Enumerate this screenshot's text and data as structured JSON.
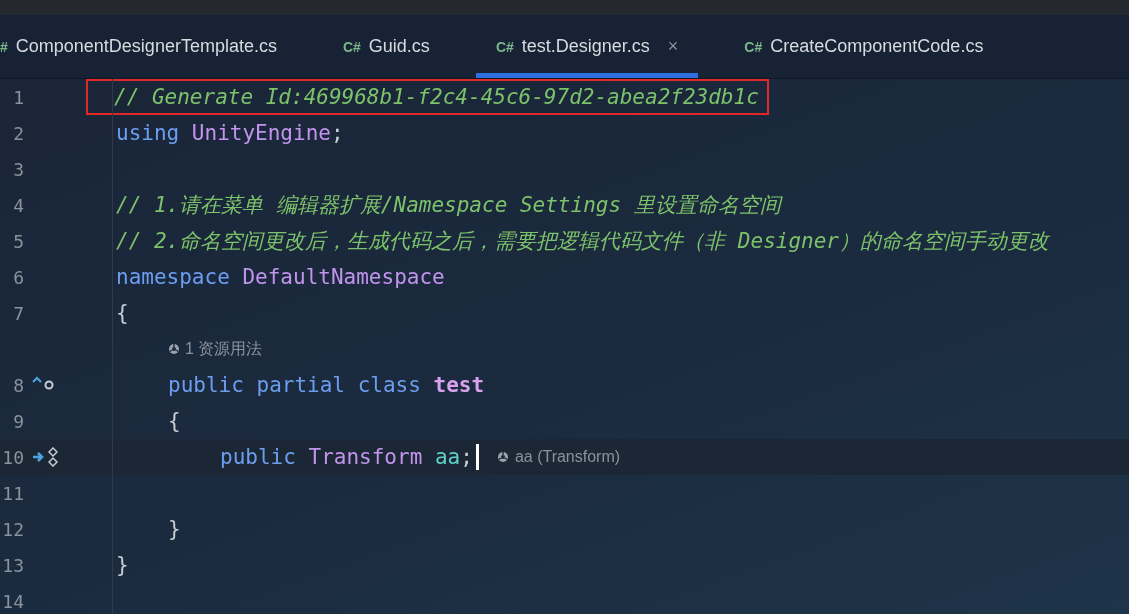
{
  "tabs": [
    {
      "icon": "#",
      "label": "ComponentDesignerTemplate.cs",
      "selected": false
    },
    {
      "icon": "C#",
      "label": "Guid.cs",
      "selected": false
    },
    {
      "icon": "C#",
      "label": "test.Designer.cs",
      "selected": true,
      "close": "×"
    },
    {
      "icon": "C#",
      "label": "CreateComponentCode.cs",
      "selected": false
    }
  ],
  "editor": {
    "lines": [
      {
        "number": "1",
        "boxed": true,
        "tokens": [
          {
            "kind": "comment",
            "text": "// Generate Id:469968b1-f2c4-45c6-97d2-abea2f23db1c"
          }
        ]
      },
      {
        "number": "2",
        "tokens": [
          {
            "kind": "keyword",
            "text": "using"
          },
          {
            "kind": "type",
            "text": "UnityEngine"
          },
          {
            "kind": "punct",
            "text": ";",
            "joined": true
          }
        ]
      },
      {
        "number": "3"
      },
      {
        "number": "4",
        "tokens": [
          {
            "kind": "comment",
            "text": "// 1.请在菜单 编辑器扩展/Namespace Settings 里设置命名空间"
          }
        ]
      },
      {
        "number": "5",
        "tokens": [
          {
            "kind": "comment",
            "text": "// 2.命名空间更改后，生成代码之后，需要把逻辑代码文件（非 Designer）的命名空间手动更改"
          }
        ]
      },
      {
        "number": "6",
        "tokens": [
          {
            "kind": "keyword",
            "text": "namespace"
          },
          {
            "kind": "type",
            "text": "DefaultNamespace"
          }
        ]
      },
      {
        "number": "7",
        "tokens": [
          {
            "kind": "punct",
            "text": "{"
          }
        ],
        "children": [
          {
            "vision": "1 资源用法",
            "number": "8",
            "gutter": {
              "kind": "implements"
            },
            "tokens": [
              {
                "kind": "keyword",
                "text": "public partial class"
              },
              {
                "kind": "class",
                "text": "test"
              }
            ]
          },
          {
            "number": "9",
            "tokens": [
              {
                "kind": "punct",
                "text": "{"
              }
            ],
            "children": [
              {
                "number": "10",
                "gutter": {
                  "kind": "serialized"
                },
                "current": true,
                "hint": "aa (Transform)",
                "tokens": [
                  {
                    "kind": "keyword",
                    "text": "public"
                  },
                  {
                    "kind": "type",
                    "text": "Transform"
                  },
                  {
                    "kind": "field",
                    "text": "aa"
                  },
                  {
                    "kind": "punct",
                    "text": ";",
                    "joined": true
                  }
                ]
              },
              {
                "number": "11"
              }
            ]
          },
          {
            "number": "12",
            "tokens": [
              {
                "kind": "punct",
                "text": "}"
              }
            ]
          }
        ]
      },
      {
        "number": "13",
        "tokens": [
          {
            "kind": "punct",
            "text": "}"
          }
        ]
      },
      {
        "number": "14"
      }
    ]
  }
}
